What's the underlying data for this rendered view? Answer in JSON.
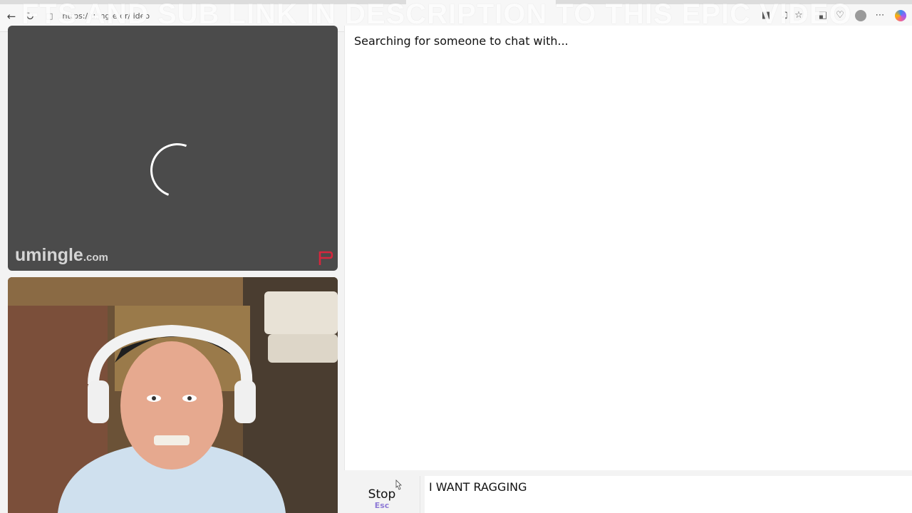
{
  "browser": {
    "url": "https://umingle.com/video",
    "url_shown": "https://u.ing.e.or/ ideo"
  },
  "overlay": {
    "title": "FTS AND SUB LINK IN DESCRIPTION TO THIS EPIC VIDEO"
  },
  "stranger_video": {
    "brand_name": "umingle",
    "brand_tld": ".com",
    "report_color": "#d7263d"
  },
  "chat": {
    "status": "Searching for someone to chat with...",
    "stop_label": "Stop",
    "stop_hint": "Esc",
    "message_value": "I WANT RAGGING"
  },
  "icons": {
    "back": "back-arrow-icon",
    "reload": "reload-icon",
    "lock": "lock-icon",
    "report": "report-flag-icon"
  }
}
